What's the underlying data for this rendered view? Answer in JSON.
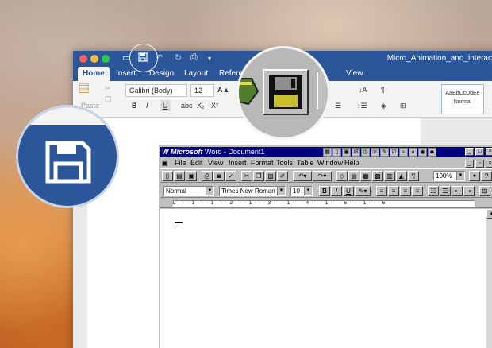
{
  "mac_word": {
    "doc_title": "Micro_Animation_and_interac",
    "tabs": [
      {
        "label": "Home"
      },
      {
        "label": "Insert"
      },
      {
        "label": "Design"
      },
      {
        "label": "Layout"
      },
      {
        "label": "Refere"
      },
      {
        "label": "View"
      }
    ],
    "ribbon": {
      "paste_label": "Paste",
      "font_name": "Calibri (Body)",
      "font_size": "12",
      "bold": "B",
      "italic": "I",
      "underline": "U",
      "strike": "abc",
      "subscript": "X₂",
      "superscript": "X²",
      "grow_font": "A▲",
      "pilcrow": "¶",
      "style_preview": "AaBbCcDdEe",
      "style_name": "Normal"
    }
  },
  "win95_word": {
    "title_brand": "Microsoft",
    "title_rest": " Word - Document1",
    "menu": [
      "File",
      "Edit",
      "View",
      "Insert",
      "Format",
      "Tools",
      "Table",
      "Window",
      "Help"
    ],
    "style_value": "Normal",
    "font_value": "Times New Roman",
    "size_value": "10",
    "zoom_value": "100%",
    "format_buttons": {
      "bold": "B",
      "italic": "I",
      "underline": "U"
    },
    "ruler_text": "L · · · 1 · · · 1 · · · 2 · · · 1 · · · 3 · · · 1 · · · 4 · · · 1 · · · 5 · · · 1 · · · 6"
  },
  "colors": {
    "word_blue": "#2b579a",
    "win95_gray": "#c0c0c0",
    "win95_title": "#000080"
  }
}
